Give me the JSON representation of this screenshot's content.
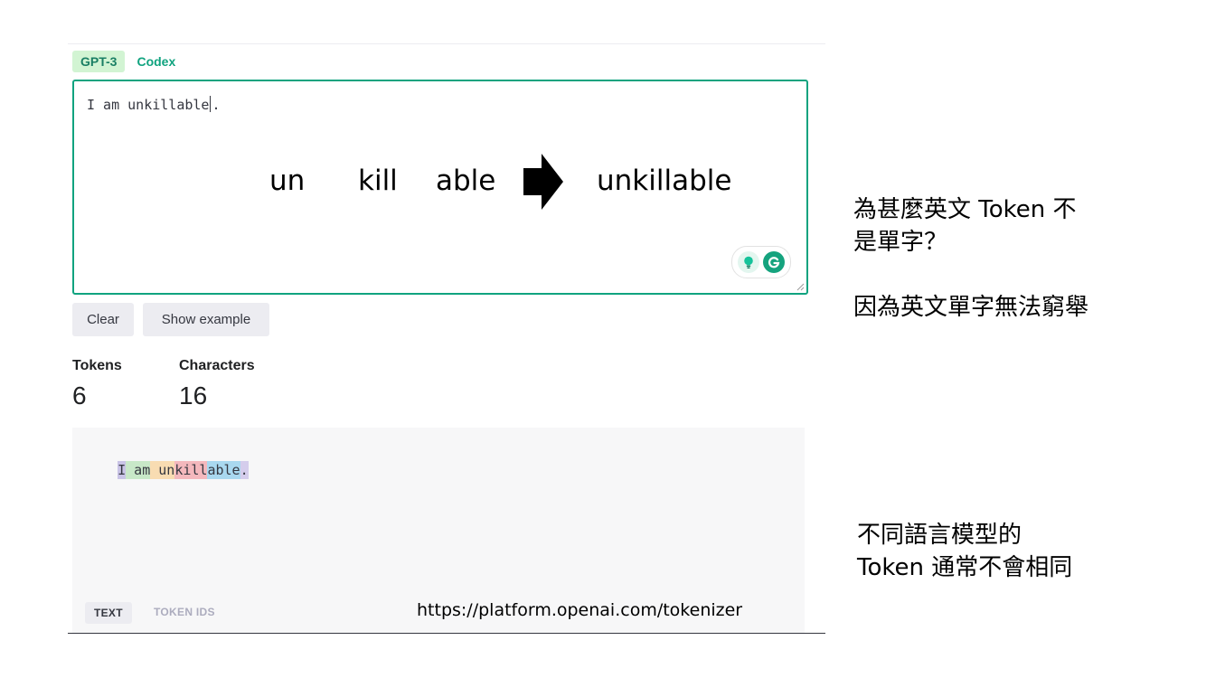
{
  "model_tabs": [
    "GPT-3",
    "Codex"
  ],
  "editor": {
    "before_caret": "I am unkillable",
    "after_caret": "."
  },
  "overlay": {
    "parts": [
      "un",
      "kill",
      "able"
    ],
    "result": "unkillable"
  },
  "buttons": {
    "clear": "Clear",
    "show_example": "Show example"
  },
  "stats": {
    "tokens_label": "Tokens",
    "tokens_value": "6",
    "characters_label": "Characters",
    "characters_value": "16"
  },
  "tokens": [
    {
      "text": "I",
      "color": "#c9c3e6"
    },
    {
      "text": " am",
      "color": "#c8e8c8"
    },
    {
      "text": " un",
      "color": "#f8dcb2"
    },
    {
      "text": "kill",
      "color": "#f4b8bd"
    },
    {
      "text": "able",
      "color": "#a9d8ef"
    },
    {
      "text": ".",
      "color": "#d5cdec"
    }
  ],
  "view_tabs": {
    "text": "TEXT",
    "token_ids": "TOKEN IDS"
  },
  "source_url": "https://platform.openai.com/tokenizer",
  "side_notes": {
    "question_line1": "為甚麼英文 Token 不",
    "question_line2": "是單字？",
    "answer": "因為英文單字無法窮舉",
    "note_line1": "不同語言模型的",
    "note_line2": "Token 通常不會相同"
  },
  "colors": {
    "accent": "#10a37f",
    "tab_active_bg": "#d2f4d3",
    "button_bg": "#ececf1",
    "output_bg": "#f7f7f8"
  },
  "icons": [
    "lightbulb-icon",
    "grammarly-icon",
    "resize-grip-icon",
    "right-arrow-icon"
  ]
}
